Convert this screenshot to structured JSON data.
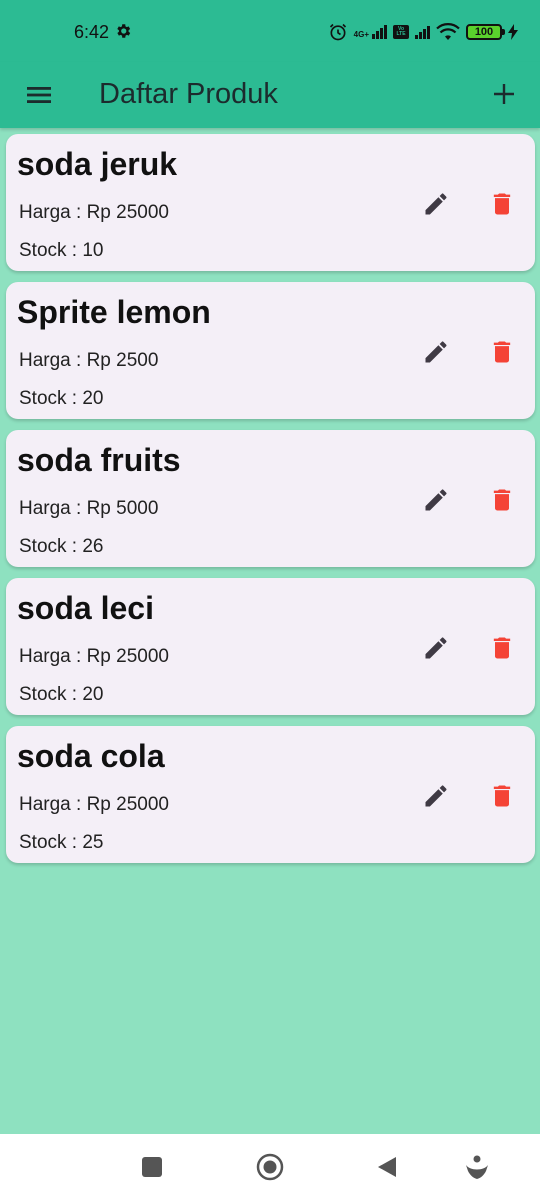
{
  "status_bar": {
    "time": "6:42",
    "network_label": "4G+",
    "volte_label": "Vo LTE",
    "battery": "100"
  },
  "app_bar": {
    "title": "Daftar Produk",
    "menu_icon": "menu-icon",
    "add_icon": "plus-icon"
  },
  "products": [
    {
      "name": "soda jeruk",
      "price": "Harga : Rp 25000",
      "stock": "Stock : 10"
    },
    {
      "name": "Sprite lemon",
      "price": "Harga : Rp 2500",
      "stock": "Stock : 20"
    },
    {
      "name": "soda fruits",
      "price": "Harga : Rp 5000",
      "stock": "Stock : 26"
    },
    {
      "name": "soda leci",
      "price": "Harga : Rp 25000",
      "stock": "Stock : 20"
    },
    {
      "name": "soda cola",
      "price": "Harga : Rp 25000",
      "stock": "Stock : 25"
    }
  ],
  "colors": {
    "app_bar": "#2cbb93",
    "background": "#8ee1c0",
    "card": "#f4eff7",
    "edit_icon": "#3f3a44",
    "delete_icon": "#f44336"
  },
  "nav_bar": {
    "items": [
      "square-icon",
      "home-circle-icon",
      "back-triangle-icon",
      "assistant-icon"
    ]
  }
}
